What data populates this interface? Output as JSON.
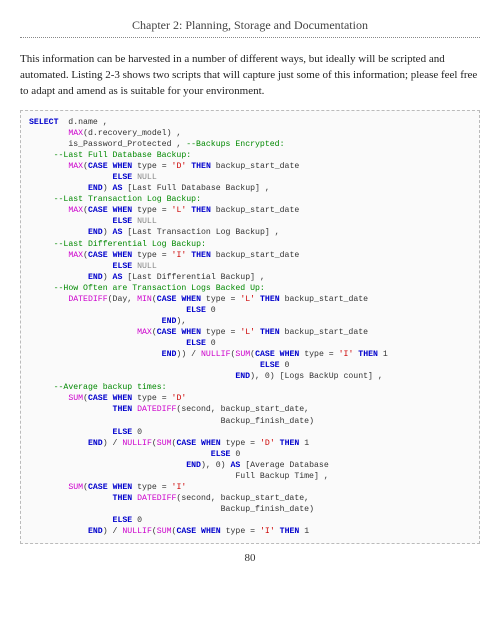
{
  "chapter_title": "Chapter 2: Planning, Storage and Documentation",
  "body_paragraph": "This information can be harvested in a number of different ways, but ideally will be scripted and automated. Listing 2-3 shows two scripts that will capture just some of this information; please feel free to adapt and amend as is suitable for your environment.",
  "page_number": "80",
  "code": {
    "l01_kw1": "SELECT",
    "l01_t1": "  d.name ,",
    "l02_fn1": "MAX",
    "l02_t1": "(d.recovery_model) ,",
    "l03_t1": "is_Password_Protected , ",
    "l03_c1": "--Backups Encrypted:",
    "l04_c1": "--Last Full Database Backup:",
    "l05_fn1": "MAX",
    "l05_t1": "(",
    "l05_kw1": "CASE",
    "l05_t2": " ",
    "l05_kw2": "WHEN",
    "l05_t3": " type = ",
    "l05_s1": "'D'",
    "l05_t4": " ",
    "l05_kw3": "THEN",
    "l05_t5": " backup_start_date",
    "l06_kw1": "ELSE",
    "l06_t1": " ",
    "l06_n1": "NULL",
    "l07_kw1": "END",
    "l07_t1": ") ",
    "l07_kw2": "AS",
    "l07_t2": " [Last Full Database Backup] ,",
    "l08_c1": "--Last Transaction Log Backup:",
    "l09_fn1": "MAX",
    "l09_t1": "(",
    "l09_kw1": "CASE",
    "l09_t2": " ",
    "l09_kw2": "WHEN",
    "l09_t3": " type = ",
    "l09_s1": "'L'",
    "l09_t4": " ",
    "l09_kw3": "THEN",
    "l09_t5": " backup_start_date",
    "l10_kw1": "ELSE",
    "l10_t1": " ",
    "l10_n1": "NULL",
    "l11_kw1": "END",
    "l11_t1": ") ",
    "l11_kw2": "AS",
    "l11_t2": " [Last Transaction Log Backup] ,",
    "l12_c1": "--Last Differential Log Backup:",
    "l13_fn1": "MAX",
    "l13_t1": "(",
    "l13_kw1": "CASE",
    "l13_t2": " ",
    "l13_kw2": "WHEN",
    "l13_t3": " type = ",
    "l13_s1": "'I'",
    "l13_t4": " ",
    "l13_kw3": "THEN",
    "l13_t5": " backup_start_date",
    "l14_kw1": "ELSE",
    "l14_t1": " ",
    "l14_n1": "NULL",
    "l15_kw1": "END",
    "l15_t1": ") ",
    "l15_kw2": "AS",
    "l15_t2": " [Last Differential Backup] ,",
    "l16_c1": "--How Often are Transaction Logs Backed Up:",
    "l17_fn1": "DATEDIFF",
    "l17_t1": "(Day, ",
    "l17_fn2": "MIN",
    "l17_t2": "(",
    "l17_kw1": "CASE",
    "l17_t3": " ",
    "l17_kw2": "WHEN",
    "l17_t4": " type = ",
    "l17_s1": "'L'",
    "l17_t5": " ",
    "l17_kw3": "THEN",
    "l17_t6": " backup_start_date",
    "l18_kw1": "ELSE",
    "l18_t1": " 0",
    "l19_kw1": "END",
    "l19_t1": "),",
    "l20_fn1": "MAX",
    "l20_t1": "(",
    "l20_kw1": "CASE",
    "l20_t2": " ",
    "l20_kw2": "WHEN",
    "l20_t3": " type = ",
    "l20_s1": "'L'",
    "l20_t4": " ",
    "l20_kw3": "THEN",
    "l20_t5": " backup_start_date",
    "l21_kw1": "ELSE",
    "l21_t1": " 0",
    "l22_kw1": "END",
    "l22_t1": ")) / ",
    "l22_fn1": "NULLIF",
    "l22_t2": "(",
    "l22_fn2": "SUM",
    "l22_t3": "(",
    "l22_kw2": "CASE",
    "l22_t4": " ",
    "l22_kw3": "WHEN",
    "l22_t5": " type = ",
    "l22_s1": "'I'",
    "l22_t6": " ",
    "l22_kw4": "THEN",
    "l22_t7": " 1",
    "l23_kw1": "ELSE",
    "l23_t1": " 0",
    "l24_kw1": "END",
    "l24_t1": "), 0) [Logs BackUp count] ,",
    "l25_c1": "--Average backup times:",
    "l26_fn1": "SUM",
    "l26_t1": "(",
    "l26_kw1": "CASE",
    "l26_t2": " ",
    "l26_kw2": "WHEN",
    "l26_t3": " type = ",
    "l26_s1": "'D'",
    "l27_kw1": "THEN",
    "l27_t1": " ",
    "l27_fn1": "DATEDIFF",
    "l27_t2": "(second, backup_start_date,",
    "l28_t1": "Backup_finish_date)",
    "l29_kw1": "ELSE",
    "l29_t1": " 0",
    "l30_kw1": "END",
    "l30_t1": ") / ",
    "l30_fn1": "NULLIF",
    "l30_t2": "(",
    "l30_fn2": "SUM",
    "l30_t3": "(",
    "l30_kw2": "CASE",
    "l30_t4": " ",
    "l30_kw3": "WHEN",
    "l30_t5": " type = ",
    "l30_s1": "'D'",
    "l30_t6": " ",
    "l30_kw4": "THEN",
    "l30_t7": " 1",
    "l31_kw1": "ELSE",
    "l31_t1": " 0",
    "l32_kw1": "END",
    "l32_t1": "), 0) ",
    "l32_kw2": "AS",
    "l32_t2": " [Average Database",
    "l33_t1": "Full Backup Time] ,",
    "l34_fn1": "SUM",
    "l34_t1": "(",
    "l34_kw1": "CASE",
    "l34_t2": " ",
    "l34_kw2": "WHEN",
    "l34_t3": " type = ",
    "l34_s1": "'I'",
    "l35_kw1": "THEN",
    "l35_t1": " ",
    "l35_fn1": "DATEDIFF",
    "l35_t2": "(second, backup_start_date,",
    "l36_t1": "Backup_finish_date)",
    "l37_kw1": "ELSE",
    "l37_t1": " 0",
    "l38_kw1": "END",
    "l38_t1": ") / ",
    "l38_fn1": "NULLIF",
    "l38_t2": "(",
    "l38_fn2": "SUM",
    "l38_t3": "(",
    "l38_kw2": "CASE",
    "l38_t4": " ",
    "l38_kw3": "WHEN",
    "l38_t5": " type = ",
    "l38_s1": "'I'",
    "l38_t6": " ",
    "l38_kw4": "THEN",
    "l38_t7": " 1"
  }
}
